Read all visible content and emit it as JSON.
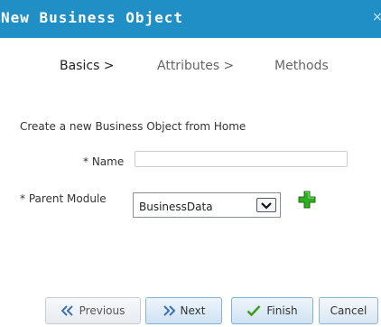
{
  "dialog": {
    "title": "New Business Object",
    "close_glyph": "×"
  },
  "steps": [
    {
      "label": "Basics >",
      "state": "active"
    },
    {
      "label": "Attributes >",
      "state": "inactive"
    },
    {
      "label": "Methods",
      "state": "inactive"
    }
  ],
  "form": {
    "intro": "Create a new Business Object from Home",
    "name_label": "* Name",
    "name_value": "",
    "parent_module_label": "* Parent Module",
    "parent_module_value": "BusinessData",
    "add_icon": "green-plus-icon"
  },
  "buttons": {
    "previous": "Previous",
    "next": "Next",
    "finish": "Finish",
    "cancel": "Cancel"
  },
  "colors": {
    "titlebar": "#1f8fc6",
    "add_icon": "#2fae1f",
    "previous_icon": "#3d6fb6",
    "next_icon": "#3d6fb6",
    "finish_icon": "#3a9a1a"
  }
}
